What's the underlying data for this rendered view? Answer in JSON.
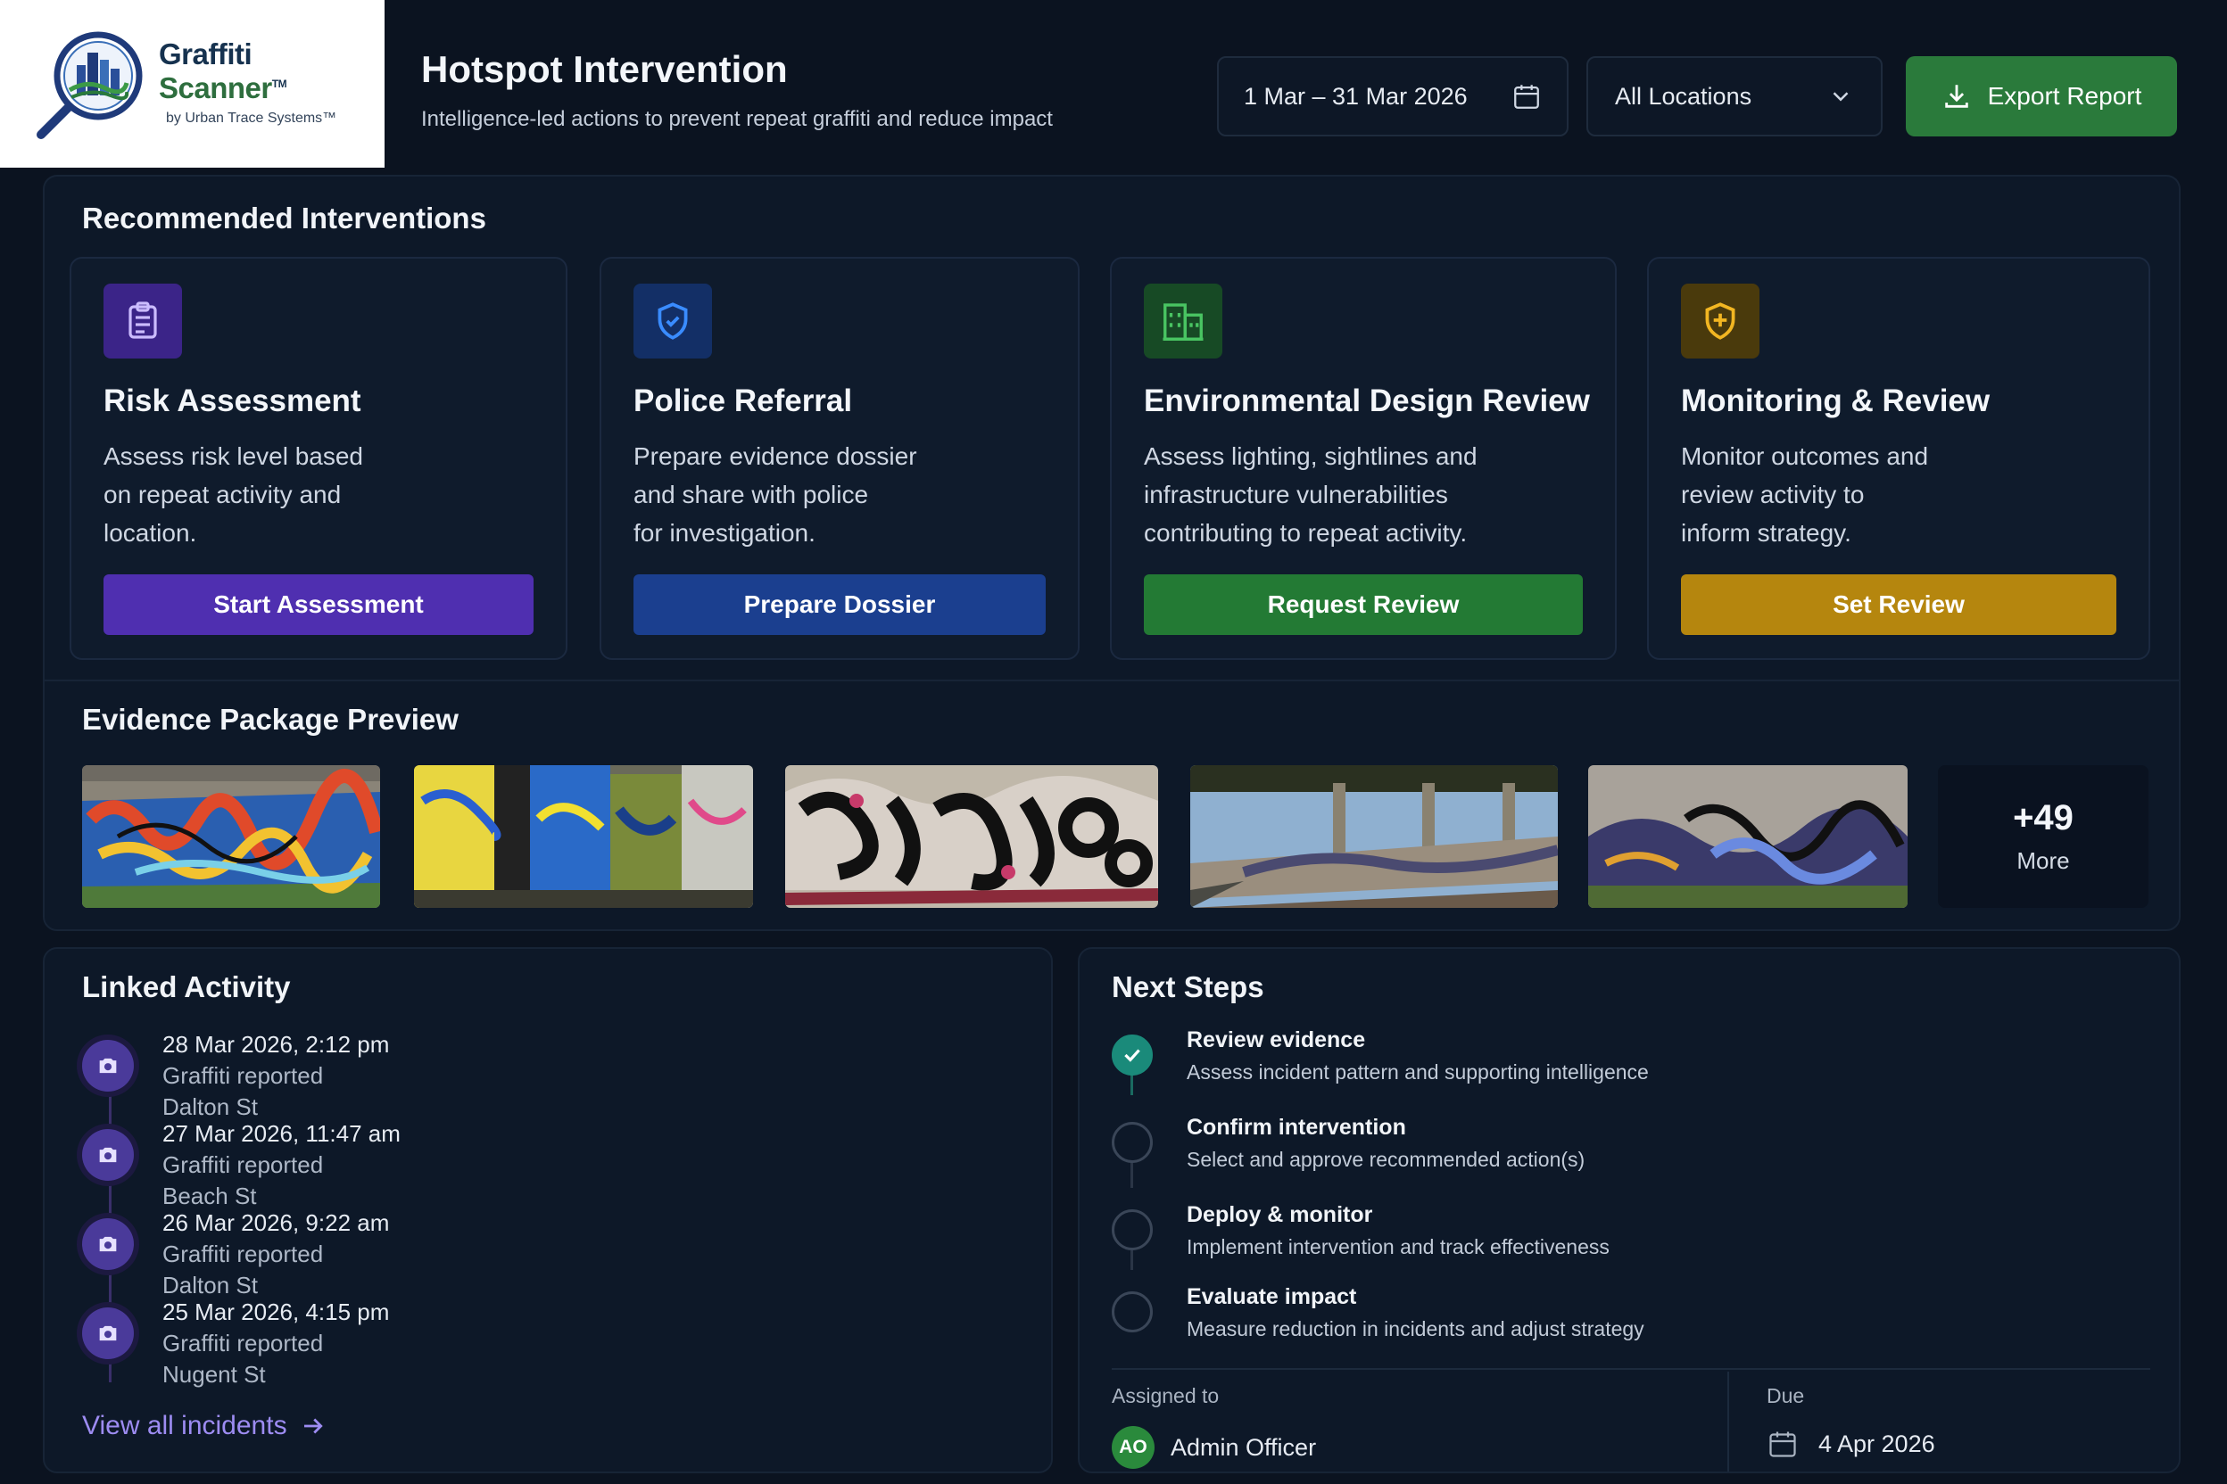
{
  "brand": {
    "name_part1": "Graffiti",
    "name_part2": " Scanner",
    "tm": "TM",
    "byline": "by Urban Trace Systems™"
  },
  "header": {
    "title": "Hotspot Intervention",
    "subtitle": "Intelligence-led actions to prevent repeat graffiti and reduce impact",
    "date_range": "1 Mar – 31 Mar 2026",
    "location_selected": "All Locations",
    "export_label": "Export Report"
  },
  "interventions": {
    "title": "Recommended Interventions",
    "cards": [
      {
        "title": "Risk Assessment",
        "lines": [
          "Assess risk level based",
          "on repeat activity and",
          "location."
        ],
        "button": "Start Assessment",
        "icon": "clipboard-icon",
        "color": "#4f2fb0"
      },
      {
        "title": "Police Referral",
        "lines": [
          "Prepare evidence dossier",
          "and share with police",
          "for investigation."
        ],
        "button": "Prepare Dossier",
        "icon": "shield-check-icon",
        "color": "#1b3f8f"
      },
      {
        "title": "Environmental Design Review",
        "lines": [
          "Assess lighting, sightlines and",
          "infrastructure vulnerabilities",
          "contributing to repeat activity."
        ],
        "button": "Request Review",
        "icon": "building-icon",
        "color": "#237a34"
      },
      {
        "title": "Monitoring & Review",
        "lines": [
          "Monitor outcomes and",
          "review activity to",
          "inform strategy."
        ],
        "button": "Set Review",
        "icon": "shield-plus-icon",
        "color": "#b5860e"
      }
    ]
  },
  "evidence": {
    "title": "Evidence Package Preview",
    "more_count": "+49",
    "more_label": "More"
  },
  "activity": {
    "title": "Linked Activity",
    "items": [
      {
        "date": "28 Mar 2026, 2:12 pm",
        "type": "Graffiti reported",
        "location": "Dalton St"
      },
      {
        "date": "27 Mar 2026, 11:47 am",
        "type": "Graffiti reported",
        "location": "Beach St"
      },
      {
        "date": "26 Mar 2026, 9:22 am",
        "type": "Graffiti reported",
        "location": "Dalton St"
      },
      {
        "date": "25 Mar 2026, 4:15 pm",
        "type": "Graffiti reported",
        "location": "Nugent St"
      }
    ],
    "view_all": "View all incidents"
  },
  "steps": {
    "title": "Next Steps",
    "items": [
      {
        "title": "Review evidence",
        "desc": "Assess incident pattern and supporting intelligence",
        "done": true
      },
      {
        "title": "Confirm intervention",
        "desc": "Select and approve recommended action(s)",
        "done": false
      },
      {
        "title": "Deploy & monitor",
        "desc": "Implement intervention and track effectiveness",
        "done": false
      },
      {
        "title": "Evaluate impact",
        "desc": "Measure reduction in incidents and adjust strategy",
        "done": false
      }
    ],
    "assigned_label": "Assigned to",
    "assignee_initials": "AO",
    "assignee_name": "Admin Officer",
    "due_label": "Due",
    "due_date": "4 Apr 2026"
  },
  "colors": {
    "background": "#0b1320",
    "accent_green": "#2a7a3b",
    "accent_purple": "#9d8cf2"
  }
}
